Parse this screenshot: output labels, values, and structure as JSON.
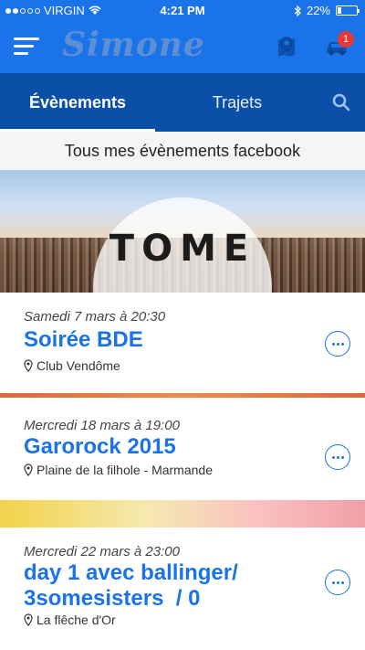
{
  "status_bar": {
    "carrier": "VIRGIN",
    "time": "4:21 PM",
    "battery": "22%",
    "battery_level": 0.22
  },
  "header": {
    "app_name": "Simone",
    "notification_count": "1"
  },
  "tabs": [
    {
      "label": "Évènements",
      "active": true
    },
    {
      "label": "Trajets",
      "active": false
    }
  ],
  "section_title": "Tous mes évènements facebook",
  "banner": {
    "brand": "TOME"
  },
  "events": [
    {
      "date": "Samedi 7 mars à 20:30",
      "title": "Soirée BDE",
      "place": "Club Vendôme"
    },
    {
      "date": "Mercredi 18 mars à 19:00",
      "title": "Garorock 2015",
      "place": "Plaine de la filhole - Marmande"
    },
    {
      "date": "Mercredi 22 mars à 23:00",
      "title_line1": "day 1 avec ballinger/",
      "title_line2": "3somesisters  / 0",
      "place": "La flêche d'Or"
    }
  ],
  "colors": {
    "brand_blue": "#1a73e8",
    "tab_bar": "#0c4fa8",
    "badge": "#e53935"
  }
}
